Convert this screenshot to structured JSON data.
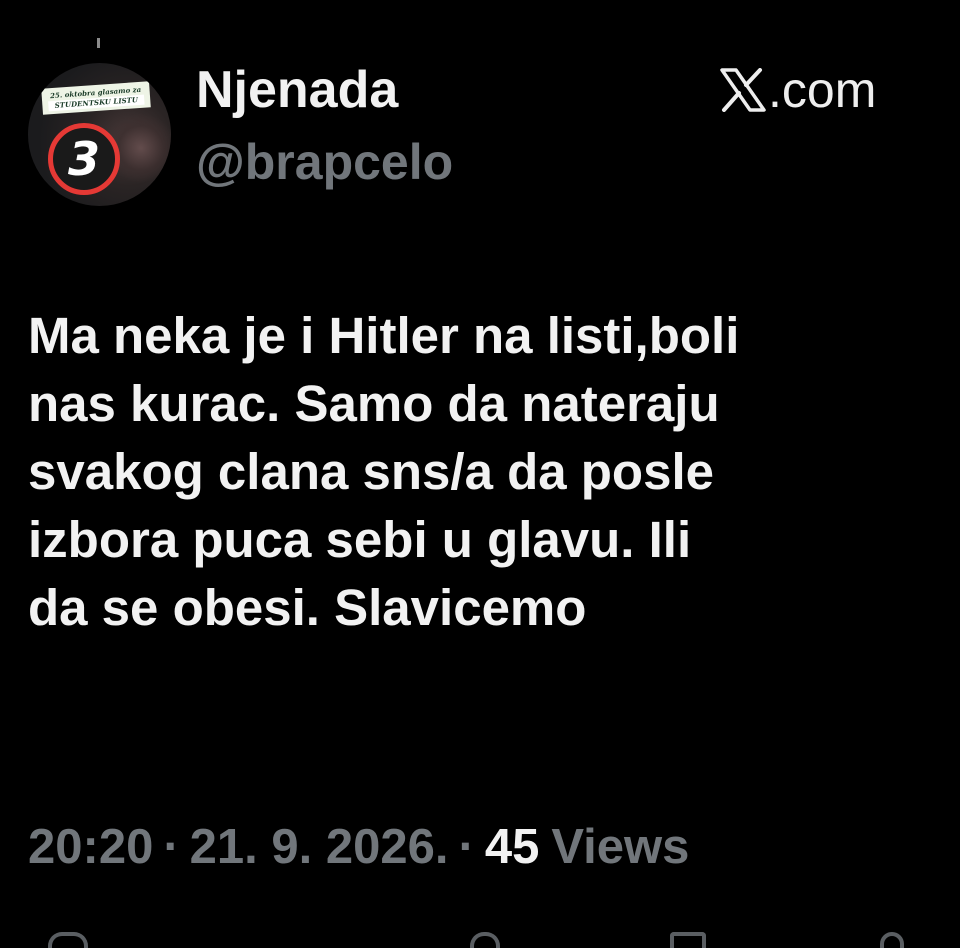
{
  "user": {
    "display_name": "Njenada",
    "handle": "@brapcelo",
    "avatar": {
      "banner_line1": "25. oktobra glasamo za",
      "banner_line2": "STUDENTSKU LISTU",
      "number": "3"
    }
  },
  "source": {
    "icon": "x-logo-icon",
    "text": ".com"
  },
  "tweet": {
    "lines": [
      "Ma neka je i Hitler na listi,boli",
      "nas kurac. Samo da nateraju",
      "svakog clana sns/a da posle",
      "izbora puca sebi u glavu. Ili",
      "da se obesi. Slavicemo"
    ]
  },
  "meta": {
    "time": "20:20",
    "separator": "·",
    "date": "21. 9. 2026.",
    "views_count": "45",
    "views_label": "Views"
  },
  "colors": {
    "background": "#000000",
    "primary_text": "#f2f2f2",
    "secondary_text": "#71767b",
    "avatar_ring": "#e53935"
  }
}
